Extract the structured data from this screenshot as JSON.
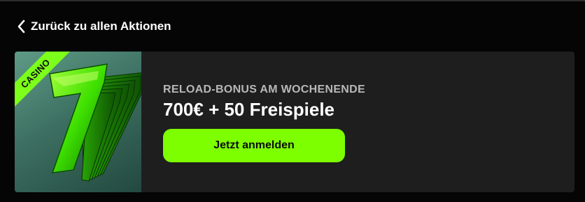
{
  "nav": {
    "back_label": "Zurück zu allen Aktionen"
  },
  "promo": {
    "badge_label": "CASINO",
    "subtitle": "RELOAD-BONUS AM WOCHENENDE",
    "title": "700€ + 50 Freispiele",
    "cta_label": "Jetzt anmelden",
    "image_icon": "slot-seven-icon"
  },
  "colors": {
    "background": "#050505",
    "card": "#1e1e1e",
    "accent": "#7dff00",
    "subtitle": "#b8b8b8"
  }
}
